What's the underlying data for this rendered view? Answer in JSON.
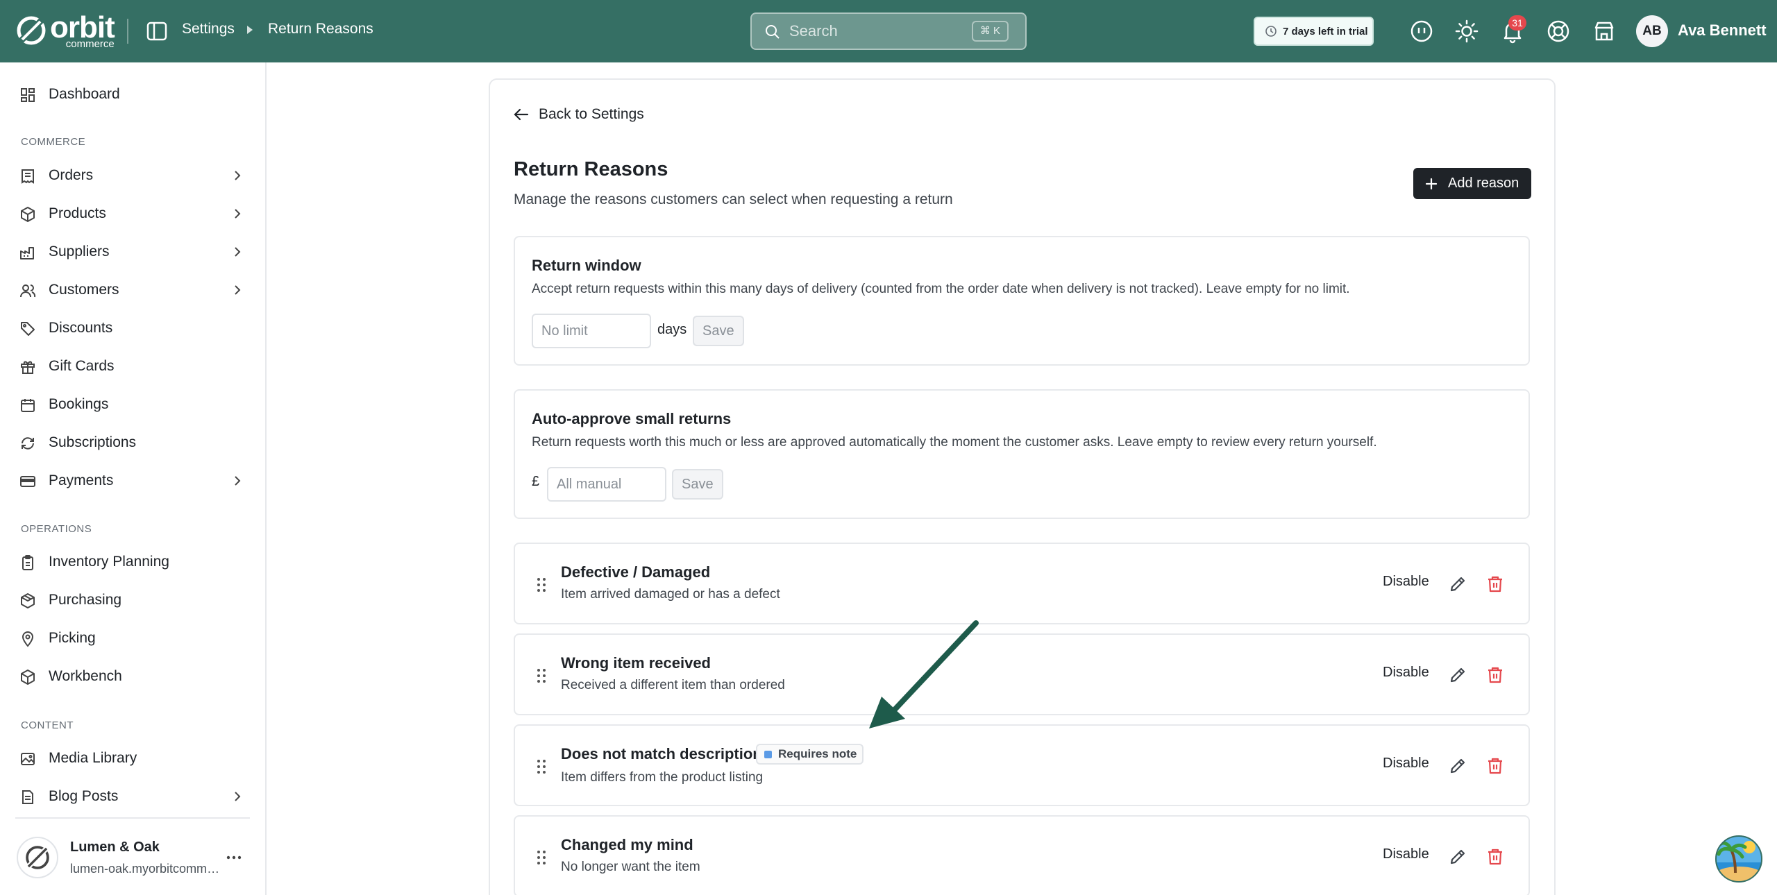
{
  "brand": {
    "word": "orbit",
    "sub": "commerce"
  },
  "breadcrumb": [
    "Settings",
    "Return Reasons"
  ],
  "search": {
    "placeholder": "Search",
    "shortcut": "⌘ K"
  },
  "trial": {
    "label": "7 days left in trial"
  },
  "notifications": {
    "count": "31"
  },
  "user": {
    "initials": "AB",
    "name": "Ava Bennett"
  },
  "sidebar": {
    "dashboard": "Dashboard",
    "sections": {
      "commerce": "COMMERCE",
      "operations": "OPERATIONS",
      "content": "CONTENT"
    },
    "commerce_items": [
      "Orders",
      "Products",
      "Suppliers",
      "Customers",
      "Discounts",
      "Gift Cards",
      "Bookings",
      "Subscriptions",
      "Payments"
    ],
    "operations_items": [
      "Inventory Planning",
      "Purchasing",
      "Picking",
      "Workbench"
    ],
    "content_items": [
      "Media Library",
      "Blog Posts"
    ],
    "store": {
      "name": "Lumen & Oak",
      "url": "lumen-oak.myorbitcommerce.com"
    }
  },
  "page": {
    "back": "Back to Settings",
    "title": "Return Reasons",
    "subtitle": "Manage the reasons customers can select when requesting a return",
    "add_button": "Add reason"
  },
  "return_window": {
    "title": "Return window",
    "description": "Accept return requests within this many days of delivery (counted from the order date when delivery is not tracked). Leave empty for no limit.",
    "placeholder": "No limit",
    "unit": "days",
    "save": "Save"
  },
  "auto_approve": {
    "title": "Auto-approve small returns",
    "description": "Return requests worth this much or less are approved automatically the moment the customer asks. Leave empty to review every return yourself.",
    "currency": "£",
    "placeholder": "All manual",
    "save": "Save"
  },
  "reasons": [
    {
      "title": "Defective / Damaged",
      "description": "Item arrived damaged or has a defect",
      "badge": "",
      "action": "Disable"
    },
    {
      "title": "Wrong item received",
      "description": "Received a different item than ordered",
      "badge": "",
      "action": "Disable"
    },
    {
      "title": "Does not match description",
      "description": "Item differs from the product listing",
      "badge": "Requires note",
      "action": "Disable"
    },
    {
      "title": "Changed my mind",
      "description": "No longer want the item",
      "badge": "",
      "action": "Disable"
    }
  ],
  "colors": {
    "topbar": "#356f64",
    "danger": "#e5484d",
    "arrow": "#1e5b4b",
    "badge_dot": "#5b9be6"
  }
}
